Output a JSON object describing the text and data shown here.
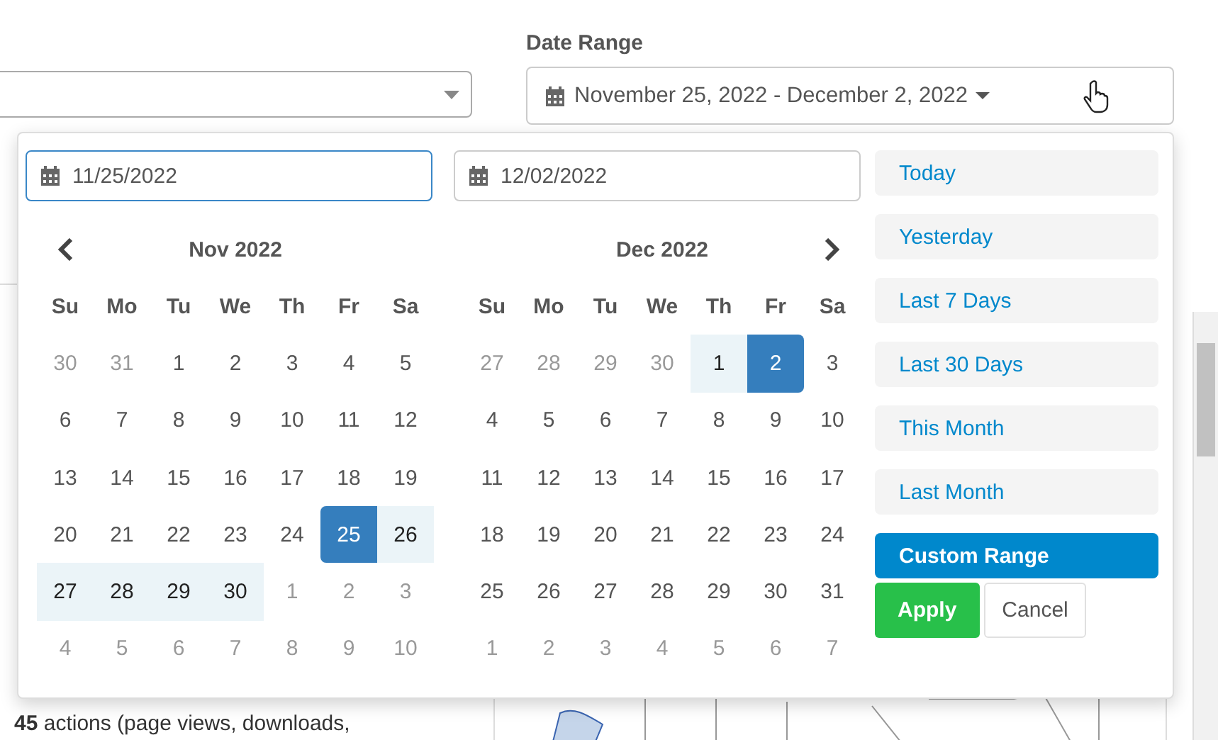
{
  "filter": {
    "label": "Date Range",
    "value": "November 25, 2022 - December 2, 2022"
  },
  "background": {
    "summary": "**45** actions (page views, downloads,"
  },
  "picker": {
    "start_input": "11/25/2022",
    "end_input": "12/02/2022",
    "months": [
      {
        "title": "Nov 2022",
        "kind": "prev",
        "weekdays": [
          "Su",
          "Mo",
          "Tu",
          "We",
          "Th",
          "Fr",
          "Sa"
        ],
        "weeks": [
          [
            {
              "d": "30",
              "kind": "off"
            },
            {
              "d": "31",
              "kind": "off"
            },
            {
              "d": "1",
              "kind": "normal"
            },
            {
              "d": "2",
              "kind": "normal"
            },
            {
              "d": "3",
              "kind": "normal"
            },
            {
              "d": "4",
              "kind": "normal"
            },
            {
              "d": "5",
              "kind": "normal"
            }
          ],
          [
            {
              "d": "6",
              "kind": "normal"
            },
            {
              "d": "7",
              "kind": "normal"
            },
            {
              "d": "8",
              "kind": "normal"
            },
            {
              "d": "9",
              "kind": "normal"
            },
            {
              "d": "10",
              "kind": "normal"
            },
            {
              "d": "11",
              "kind": "normal"
            },
            {
              "d": "12",
              "kind": "normal"
            }
          ],
          [
            {
              "d": "13",
              "kind": "normal"
            },
            {
              "d": "14",
              "kind": "normal"
            },
            {
              "d": "15",
              "kind": "normal"
            },
            {
              "d": "16",
              "kind": "normal"
            },
            {
              "d": "17",
              "kind": "normal"
            },
            {
              "d": "18",
              "kind": "normal"
            },
            {
              "d": "19",
              "kind": "normal"
            }
          ],
          [
            {
              "d": "20",
              "kind": "normal"
            },
            {
              "d": "21",
              "kind": "normal"
            },
            {
              "d": "22",
              "kind": "normal"
            },
            {
              "d": "23",
              "kind": "normal"
            },
            {
              "d": "24",
              "kind": "normal"
            },
            {
              "d": "25",
              "kind": "start"
            },
            {
              "d": "26",
              "kind": "range"
            }
          ],
          [
            {
              "d": "27",
              "kind": "range"
            },
            {
              "d": "28",
              "kind": "range"
            },
            {
              "d": "29",
              "kind": "range"
            },
            {
              "d": "30",
              "kind": "range"
            },
            {
              "d": "1",
              "kind": "off"
            },
            {
              "d": "2",
              "kind": "off"
            },
            {
              "d": "3",
              "kind": "off"
            }
          ],
          [
            {
              "d": "4",
              "kind": "off"
            },
            {
              "d": "5",
              "kind": "off"
            },
            {
              "d": "6",
              "kind": "off"
            },
            {
              "d": "7",
              "kind": "off"
            },
            {
              "d": "8",
              "kind": "off"
            },
            {
              "d": "9",
              "kind": "off"
            },
            {
              "d": "10",
              "kind": "off"
            }
          ]
        ]
      },
      {
        "title": "Dec 2022",
        "kind": "next",
        "weekdays": [
          "Su",
          "Mo",
          "Tu",
          "We",
          "Th",
          "Fr",
          "Sa"
        ],
        "weeks": [
          [
            {
              "d": "27",
              "kind": "off"
            },
            {
              "d": "28",
              "kind": "off"
            },
            {
              "d": "29",
              "kind": "off"
            },
            {
              "d": "30",
              "kind": "off"
            },
            {
              "d": "1",
              "kind": "range"
            },
            {
              "d": "2",
              "kind": "end"
            },
            {
              "d": "3",
              "kind": "normal"
            }
          ],
          [
            {
              "d": "4",
              "kind": "normal"
            },
            {
              "d": "5",
              "kind": "normal"
            },
            {
              "d": "6",
              "kind": "normal"
            },
            {
              "d": "7",
              "kind": "normal"
            },
            {
              "d": "8",
              "kind": "normal"
            },
            {
              "d": "9",
              "kind": "normal"
            },
            {
              "d": "10",
              "kind": "normal"
            }
          ],
          [
            {
              "d": "11",
              "kind": "normal"
            },
            {
              "d": "12",
              "kind": "normal"
            },
            {
              "d": "13",
              "kind": "normal"
            },
            {
              "d": "14",
              "kind": "normal"
            },
            {
              "d": "15",
              "kind": "normal"
            },
            {
              "d": "16",
              "kind": "normal"
            },
            {
              "d": "17",
              "kind": "normal"
            }
          ],
          [
            {
              "d": "18",
              "kind": "normal"
            },
            {
              "d": "19",
              "kind": "normal"
            },
            {
              "d": "20",
              "kind": "normal"
            },
            {
              "d": "21",
              "kind": "normal"
            },
            {
              "d": "22",
              "kind": "normal"
            },
            {
              "d": "23",
              "kind": "normal"
            },
            {
              "d": "24",
              "kind": "normal"
            }
          ],
          [
            {
              "d": "25",
              "kind": "normal"
            },
            {
              "d": "26",
              "kind": "normal"
            },
            {
              "d": "27",
              "kind": "normal"
            },
            {
              "d": "28",
              "kind": "normal"
            },
            {
              "d": "29",
              "kind": "normal"
            },
            {
              "d": "30",
              "kind": "normal"
            },
            {
              "d": "31",
              "kind": "normal"
            }
          ],
          [
            {
              "d": "1",
              "kind": "off"
            },
            {
              "d": "2",
              "kind": "off"
            },
            {
              "d": "3",
              "kind": "off"
            },
            {
              "d": "4",
              "kind": "off"
            },
            {
              "d": "5",
              "kind": "off"
            },
            {
              "d": "6",
              "kind": "off"
            },
            {
              "d": "7",
              "kind": "off"
            }
          ]
        ]
      }
    ],
    "ranges": [
      {
        "label": "Today",
        "selected": false
      },
      {
        "label": "Yesterday",
        "selected": false
      },
      {
        "label": "Last 7 Days",
        "selected": false
      },
      {
        "label": "Last 30 Days",
        "selected": false
      },
      {
        "label": "This Month",
        "selected": false
      },
      {
        "label": "Last Month",
        "selected": false
      },
      {
        "label": "Custom Range",
        "selected": true
      }
    ],
    "apply": "Apply",
    "cancel": "Cancel"
  }
}
